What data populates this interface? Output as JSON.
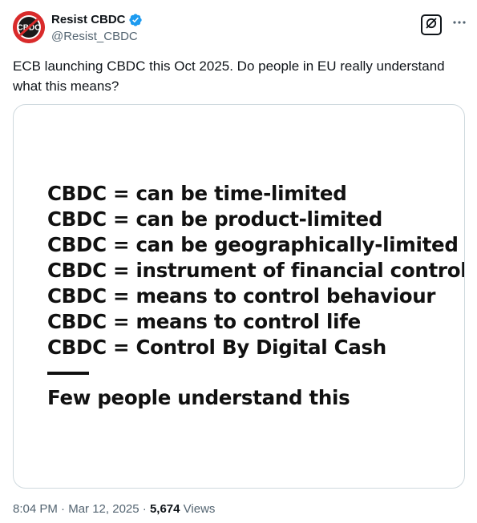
{
  "author": {
    "display_name": "Resist CBDC",
    "handle": "@Resist_CBDC",
    "verified": true,
    "avatar_text": "CBDC"
  },
  "tweet": {
    "text": "ECB launching CBDC this Oct 2025.  Do people in EU really understand what this means?"
  },
  "media": {
    "lines": [
      "CBDC = can be time-limited",
      "CBDC = can be product-limited",
      "CBDC = can be geographically-limited",
      "CBDC = instrument of financial control",
      "CBDC = means to control behaviour",
      "CBDC = means to control life",
      "CBDC = Control By Digital Cash"
    ],
    "footer": "Few people understand this"
  },
  "meta": {
    "time": "8:04 PM",
    "separator1": " · ",
    "date": "Mar 12, 2025",
    "separator2": " · ",
    "views_count": "5,674",
    "views_label": " Views"
  },
  "icons": {
    "verified": "verified-badge-icon",
    "grok": "grok-icon",
    "more": "more-dots-icon"
  },
  "colors": {
    "verified_blue": "#1d9bf0",
    "secondary_text": "#536471",
    "avatar_red": "#d92b2b"
  }
}
